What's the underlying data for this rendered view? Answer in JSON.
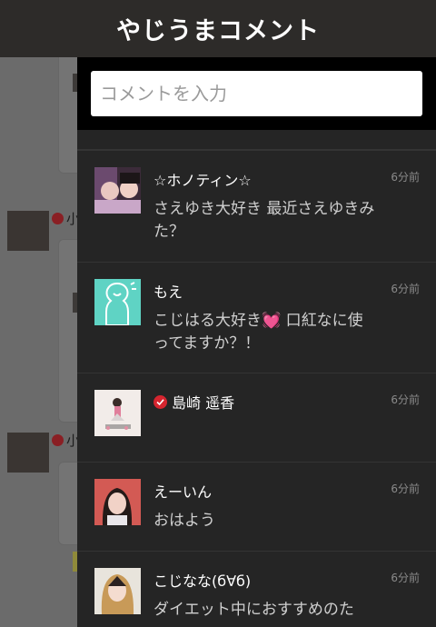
{
  "header": {
    "title": "やじうまコメント"
  },
  "input": {
    "placeholder": "コメントを入力"
  },
  "background": {
    "username_fragment_1": "小",
    "username_fragment_2": "小"
  },
  "comments": [
    {
      "name": "☆ホノティン☆",
      "verified": false,
      "time": "6分前",
      "text": "さえゆき大好き 最近さえゆきみた？"
    },
    {
      "name": "もえ",
      "verified": false,
      "time": "6分前",
      "text": "こじはる大好き💓 口紅なに使ってますか？！"
    },
    {
      "name": "島崎 遥香",
      "verified": true,
      "time": "6分前",
      "text": ""
    },
    {
      "name": "えーいん",
      "verified": false,
      "time": "6分前",
      "text": "おはよう"
    },
    {
      "name": "こじなな(б∀б)",
      "verified": false,
      "time": "6分前",
      "text": "ダイエット中におすすめのた"
    }
  ]
}
